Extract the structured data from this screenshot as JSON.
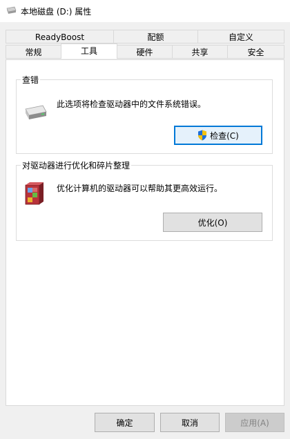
{
  "window": {
    "title": "本地磁盘 (D:) 属性"
  },
  "tabs": {
    "row1": [
      {
        "label": "ReadyBoost"
      },
      {
        "label": "配额"
      },
      {
        "label": "自定义"
      }
    ],
    "row2": [
      {
        "label": "常规"
      },
      {
        "label": "工具",
        "active": true
      },
      {
        "label": "硬件"
      },
      {
        "label": "共享"
      },
      {
        "label": "安全"
      }
    ]
  },
  "tools": {
    "error_check": {
      "group_title": "查错",
      "description": "此选项将检查驱动器中的文件系统错误。",
      "button_label": "检查(C)",
      "icon": "drive-icon"
    },
    "optimize": {
      "group_title": "对驱动器进行优化和碎片整理",
      "description": "优化计算机的驱动器可以帮助其更高效运行。",
      "button_label": "优化(O)",
      "icon": "defrag-icon"
    }
  },
  "footer": {
    "ok_label": "确定",
    "cancel_label": "取消",
    "apply_label": "应用(A)"
  }
}
